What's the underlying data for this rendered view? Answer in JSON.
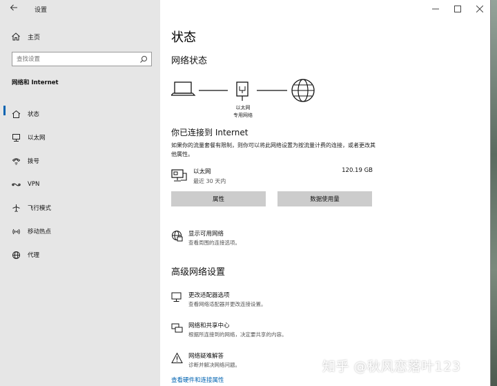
{
  "window": {
    "title": "设置"
  },
  "sidebar": {
    "home_label": "主页",
    "search_placeholder": "查找设置",
    "section_label": "网络和 Internet",
    "items": [
      {
        "label": "状态",
        "icon": "home-status-icon",
        "active": true
      },
      {
        "label": "以太网",
        "icon": "ethernet-icon"
      },
      {
        "label": "拨号",
        "icon": "dialup-icon"
      },
      {
        "label": "VPN",
        "icon": "vpn-icon"
      },
      {
        "label": "飞行模式",
        "icon": "airplane-icon"
      },
      {
        "label": "移动热点",
        "icon": "hotspot-icon"
      },
      {
        "label": "代理",
        "icon": "globe-icon"
      }
    ]
  },
  "main": {
    "title": "状态",
    "network_status_heading": "网络状态",
    "diagram": {
      "adapter_label": "以太网",
      "network_label": "专用网络"
    },
    "connected_title": "你已连接到 Internet",
    "connected_desc": "如果你的流量套餐有限制，则你可以将此网络设置为按流量计费的连接，或者更改其他属性。",
    "adapter": {
      "name": "以太网",
      "period": "最近 30 天内",
      "usage": "120.19 GB"
    },
    "buttons": {
      "properties": "属性",
      "data_usage": "数据使用量"
    },
    "show_networks": {
      "title": "显示可用网络",
      "desc": "查看周围的连接选项。"
    },
    "advanced_heading": "高级网络设置",
    "advanced_items": [
      {
        "title": "更改适配器选项",
        "desc": "查看网络适配器并更改连接设置。"
      },
      {
        "title": "网络和共享中心",
        "desc": "根据所连接到的网络，决定要共享的内容。"
      },
      {
        "title": "网络疑难解答",
        "desc": "诊断并解决网络问题。"
      }
    ],
    "bottom_link": "查看硬件和连接属性"
  },
  "watermark": "知乎 @秋风恋落叶123",
  "colors": {
    "accent": "#0063b1",
    "sidebar_bg": "#e6e6e6",
    "button_bg": "#cccccc"
  }
}
